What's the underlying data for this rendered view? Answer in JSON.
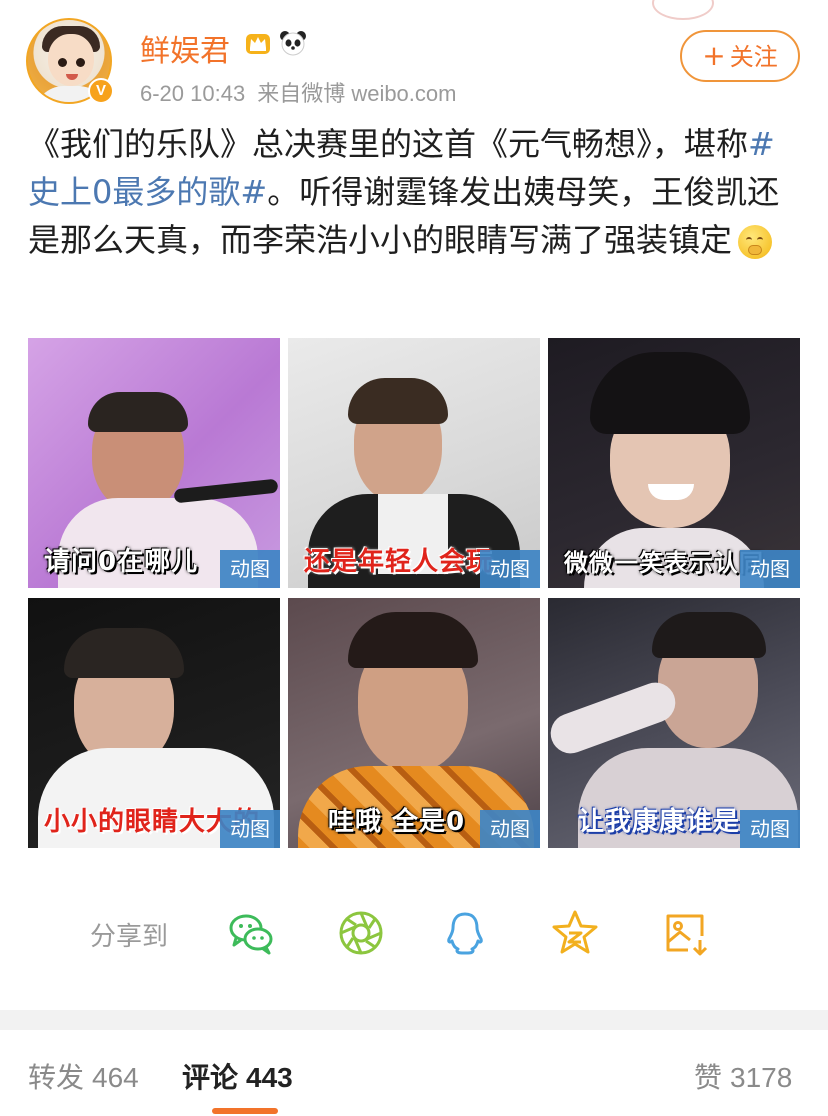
{
  "post": {
    "author": "鲜娱君",
    "timestamp": "6-20 10:43",
    "source": "来自微博 weibo.com",
    "follow_label": "关注",
    "verified_badge": "V",
    "text_part1": "《我们的乐队》总决赛里的这首《元气畅想》，堪称",
    "hashtag": "#史上0最多的歌#",
    "text_part2": "。听得谢霆锋发出姨母笑，王俊凯还是那么天真，而李荣浩小小的眼睛写满了强装镇定",
    "emoji": "thinking-face-emoji"
  },
  "media": {
    "gif_badge": "动图",
    "tiles": [
      {
        "caption": "请问0在哪儿"
      },
      {
        "caption": "还是年轻人会玩"
      },
      {
        "caption": "微微一笑表示认同"
      },
      {
        "caption": "小小的眼睛大大的"
      },
      {
        "caption": "哇哦  全是0"
      },
      {
        "caption": "让我康康谁是"
      }
    ]
  },
  "share": {
    "label": "分享到",
    "targets": [
      "wechat-icon",
      "moments-icon",
      "qq-icon",
      "qzone-icon",
      "save-image-icon"
    ]
  },
  "tabs": [
    {
      "label": "转发",
      "count": "464"
    },
    {
      "label": "评论",
      "count": "443"
    },
    {
      "label": "赞",
      "count": "3178"
    }
  ],
  "colors": {
    "accent": "#f2732a",
    "link": "#4c78b1",
    "gif_badge": "#3e84c4"
  }
}
